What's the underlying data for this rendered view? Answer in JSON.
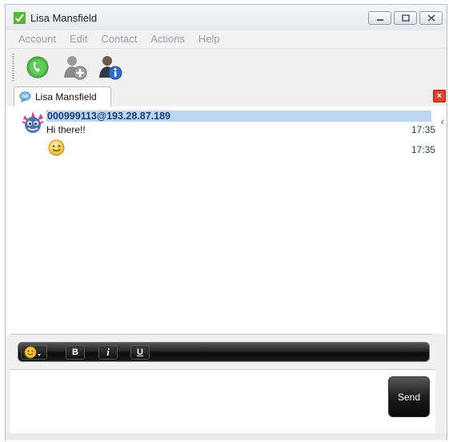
{
  "window": {
    "title": "Lisa Mansfield",
    "buttons": [
      "minimize",
      "restore",
      "close"
    ]
  },
  "menu": {
    "items": [
      "Account",
      "Edit",
      "Contact",
      "Actions",
      "Help"
    ]
  },
  "toolbar": {
    "icons": [
      "call-icon",
      "add-contact-icon",
      "contact-info-icon"
    ]
  },
  "tab": {
    "label": "Lisa Mansfield",
    "close_label": "×"
  },
  "chat": {
    "sender": "000999113@193.28.87.189",
    "messages": [
      {
        "text": "Hi there!!",
        "time": "17:35"
      },
      {
        "emoticon": "smile",
        "time": "17:35"
      }
    ]
  },
  "format": {
    "bold": "B",
    "italic": "i",
    "underline": "U"
  },
  "send": {
    "label": "Send"
  },
  "colors": {
    "sender_highlight": "#bcd6f2",
    "sender_text": "#1d3a7a",
    "tab_close": "#e04030"
  }
}
